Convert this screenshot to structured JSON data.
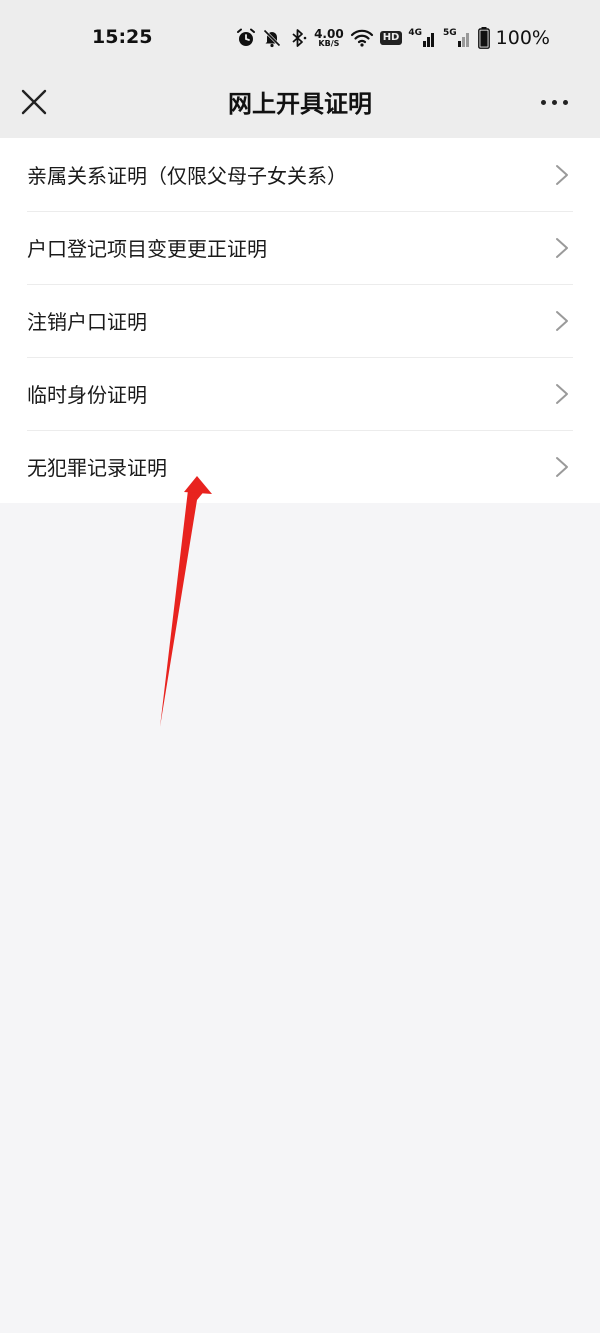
{
  "status_bar": {
    "time": "15:25",
    "speed_value": "4.00",
    "speed_unit": "KB/S",
    "hd_badge": "HD",
    "net1_label": "4G",
    "net2_label": "5G",
    "battery": "100%",
    "icons": [
      "alarm-icon",
      "mute-bell-icon",
      "bluetooth-icon",
      "wifi-icon",
      "signal-icon",
      "battery-icon"
    ]
  },
  "nav": {
    "title": "网上开具证明",
    "close_icon": "close-icon",
    "more_icon": "more-icon"
  },
  "menu": {
    "items": [
      {
        "label": "亲属关系证明（仅限父母子女关系）"
      },
      {
        "label": "户口登记项目变更更正证明"
      },
      {
        "label": "注销户口证明"
      },
      {
        "label": "临时身份证明"
      },
      {
        "label": "无犯罪记录证明"
      }
    ]
  },
  "colors": {
    "page_bg": "#f5f5f7",
    "nav_bg": "#ededed",
    "list_bg": "#ffffff",
    "annotation_arrow": "#e8231f"
  }
}
